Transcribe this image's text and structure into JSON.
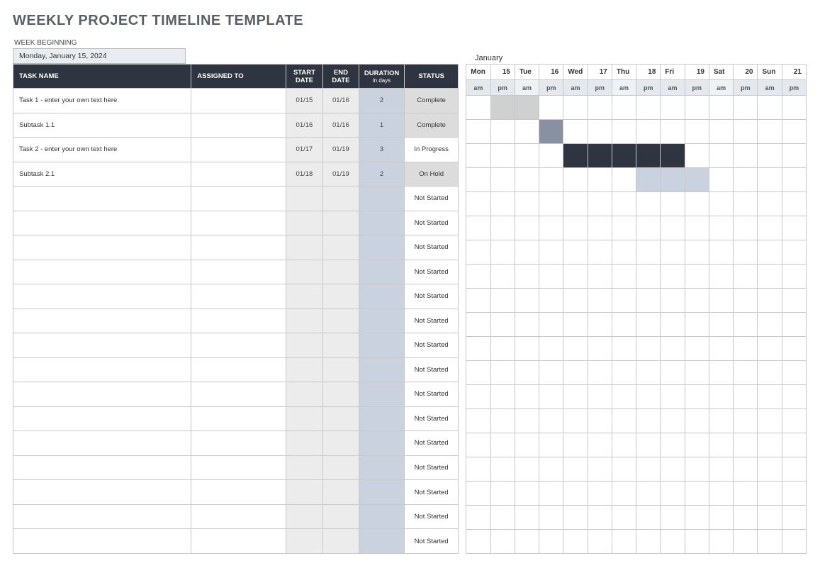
{
  "title": "WEEKLY PROJECT TIMELINE TEMPLATE",
  "week_label": "WEEK BEGINNING",
  "week_value": "Monday, January 15, 2024",
  "month_label": "January",
  "columns": {
    "task_name": "TASK NAME",
    "assigned_to": "ASSIGNED TO",
    "start_date": "START DATE",
    "end_date": "END DATE",
    "duration": "DURATION",
    "duration_sub": "in days",
    "status": "STATUS"
  },
  "days": [
    {
      "name": "Mon",
      "num": "15"
    },
    {
      "name": "Tue",
      "num": "16"
    },
    {
      "name": "Wed",
      "num": "17"
    },
    {
      "name": "Thu",
      "num": "18"
    },
    {
      "name": "Fri",
      "num": "19"
    },
    {
      "name": "Sat",
      "num": "20"
    },
    {
      "name": "Sun",
      "num": "21"
    }
  ],
  "ampm": [
    "am",
    "pm"
  ],
  "rows": [
    {
      "task": "Task 1 - enter your own text here",
      "assigned": "",
      "start": "01/15",
      "end": "01/16",
      "dur": "2",
      "status": "Complete",
      "status_cls": "status-complete",
      "bars": [
        {
          "col": 1,
          "span": 2,
          "cls": "bar-light"
        }
      ]
    },
    {
      "task": "Subtask 1.1",
      "assigned": "",
      "start": "01/16",
      "end": "01/16",
      "dur": "1",
      "status": "Complete",
      "status_cls": "status-complete",
      "bars": [
        {
          "col": 3,
          "span": 1,
          "cls": "bar-med"
        }
      ]
    },
    {
      "task": "Task 2 - enter your own text here",
      "assigned": "",
      "start": "01/17",
      "end": "01/19",
      "dur": "3",
      "status": "In Progress",
      "status_cls": "",
      "bars": [
        {
          "col": 4,
          "span": 5,
          "cls": "bar-dark"
        }
      ]
    },
    {
      "task": "Subtask 2.1",
      "assigned": "",
      "start": "01/18",
      "end": "01/19",
      "dur": "2",
      "status": "On Hold",
      "status_cls": "status-onhold",
      "bars": [
        {
          "col": 7,
          "span": 3,
          "cls": "bar-blue"
        }
      ]
    },
    {
      "task": "",
      "assigned": "",
      "start": "",
      "end": "",
      "dur": "",
      "status": "Not Started",
      "status_cls": "",
      "bars": []
    },
    {
      "task": "",
      "assigned": "",
      "start": "",
      "end": "",
      "dur": "",
      "status": "Not Started",
      "status_cls": "",
      "bars": []
    },
    {
      "task": "",
      "assigned": "",
      "start": "",
      "end": "",
      "dur": "",
      "status": "Not Started",
      "status_cls": "",
      "bars": []
    },
    {
      "task": "",
      "assigned": "",
      "start": "",
      "end": "",
      "dur": "",
      "status": "Not Started",
      "status_cls": "",
      "bars": []
    },
    {
      "task": "",
      "assigned": "",
      "start": "",
      "end": "",
      "dur": "",
      "status": "Not Started",
      "status_cls": "",
      "bars": []
    },
    {
      "task": "",
      "assigned": "",
      "start": "",
      "end": "",
      "dur": "",
      "status": "Not Started",
      "status_cls": "",
      "bars": []
    },
    {
      "task": "",
      "assigned": "",
      "start": "",
      "end": "",
      "dur": "",
      "status": "Not Started",
      "status_cls": "",
      "bars": []
    },
    {
      "task": "",
      "assigned": "",
      "start": "",
      "end": "",
      "dur": "",
      "status": "Not Started",
      "status_cls": "",
      "bars": []
    },
    {
      "task": "",
      "assigned": "",
      "start": "",
      "end": "",
      "dur": "",
      "status": "Not Started",
      "status_cls": "",
      "bars": []
    },
    {
      "task": "",
      "assigned": "",
      "start": "",
      "end": "",
      "dur": "",
      "status": "Not Started",
      "status_cls": "",
      "bars": []
    },
    {
      "task": "",
      "assigned": "",
      "start": "",
      "end": "",
      "dur": "",
      "status": "Not Started",
      "status_cls": "",
      "bars": []
    },
    {
      "task": "",
      "assigned": "",
      "start": "",
      "end": "",
      "dur": "",
      "status": "Not Started",
      "status_cls": "",
      "bars": []
    },
    {
      "task": "",
      "assigned": "",
      "start": "",
      "end": "",
      "dur": "",
      "status": "Not Started",
      "status_cls": "",
      "bars": []
    },
    {
      "task": "",
      "assigned": "",
      "start": "",
      "end": "",
      "dur": "",
      "status": "Not Started",
      "status_cls": "",
      "bars": []
    },
    {
      "task": "",
      "assigned": "",
      "start": "",
      "end": "",
      "dur": "",
      "status": "Not Started",
      "status_cls": "",
      "bars": []
    }
  ]
}
